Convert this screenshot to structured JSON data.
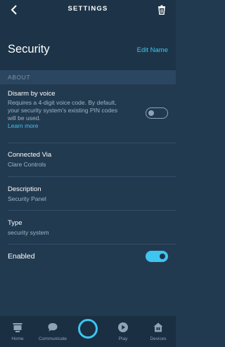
{
  "header": {
    "title": "SETTINGS",
    "back_icon": "chevron-left-icon",
    "delete_icon": "trash-icon"
  },
  "title_row": {
    "title": "Security",
    "edit_label": "Edit Name"
  },
  "section": {
    "label": "ABOUT"
  },
  "disarm": {
    "label": "Disarm by voice",
    "description_lines": [
      "Requires a 4-digit voice code. By default,",
      "your security system's existing PIN codes",
      "will be used."
    ],
    "learn_more": "Learn more",
    "enabled": false
  },
  "connected_via": {
    "label": "Connected Via",
    "value": "Clare Controls"
  },
  "description": {
    "label": "Description",
    "value": "Security Panel"
  },
  "type": {
    "label": "Type",
    "value": "security system"
  },
  "enabled_row": {
    "label": "Enabled",
    "enabled": true
  },
  "colors": {
    "background": "#223a50",
    "header": "#1d3448",
    "accent": "#3ec5f0",
    "section_header": "#2b4661"
  },
  "tabbar": {
    "tabs": [
      {
        "label": "Home",
        "icon": "home-icon"
      },
      {
        "label": "Communicate",
        "icon": "chat-bubble-icon"
      },
      {
        "label": "",
        "icon": "alexa-ring-icon"
      },
      {
        "label": "Play",
        "icon": "play-icon"
      },
      {
        "label": "Devices",
        "icon": "devices-house-icon"
      }
    ]
  }
}
